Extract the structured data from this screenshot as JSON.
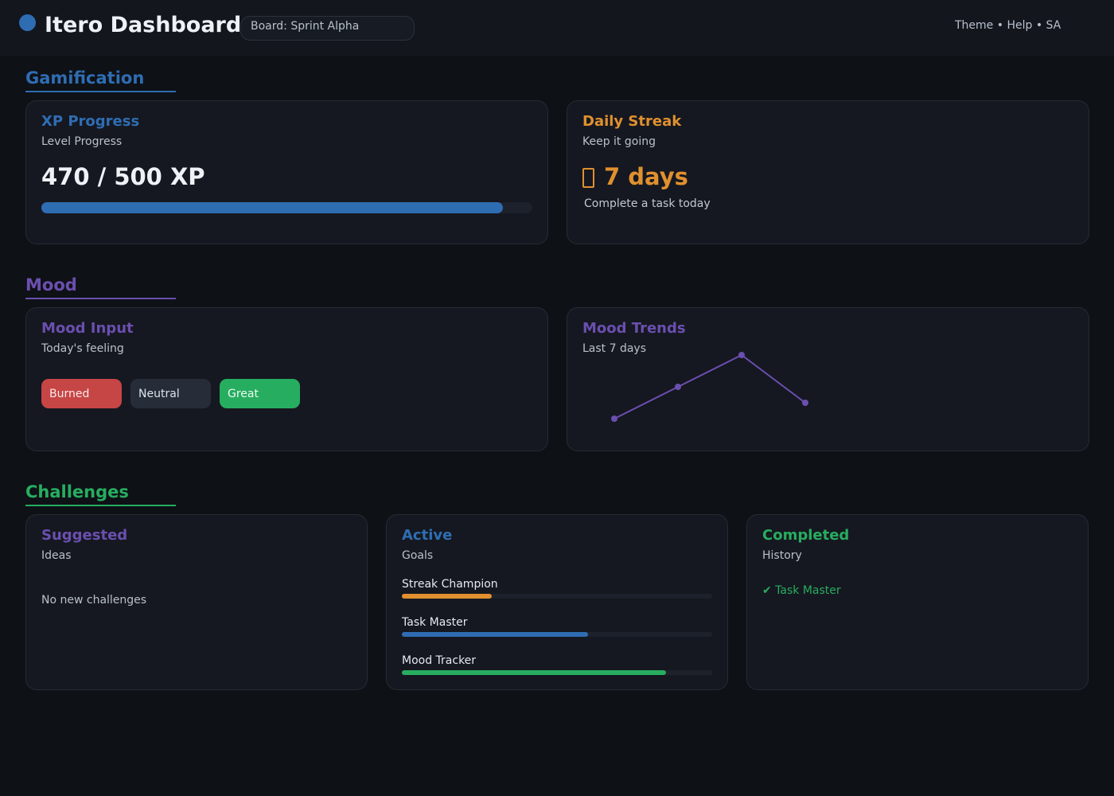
{
  "header": {
    "title": "Itero Dashboard",
    "board": "Board: Sprint Alpha",
    "links": "Theme • Help • SA"
  },
  "colors": {
    "blue": "#2f6db3",
    "orange": "#e0902f",
    "purple": "#6b4fb0",
    "green": "#27ad60",
    "red": "#c64545"
  },
  "sections": {
    "gamification": "Gamification",
    "mood": "Mood",
    "challenges": "Challenges"
  },
  "xp": {
    "title": "XP Progress",
    "subtitle": "Level Progress",
    "value": "470 / 500 XP",
    "progress": 0.94
  },
  "streak": {
    "title": "Daily Streak",
    "subtitle": "Keep it going",
    "icon": "fire-icon",
    "value": "7 days",
    "hint": "Complete a task today"
  },
  "mood_input": {
    "title": "Mood Input",
    "subtitle": "Today's feeling",
    "options": [
      "Burned",
      "Neutral",
      "Great"
    ]
  },
  "mood_trends": {
    "title": "Mood Trends",
    "subtitle": "Last 7 days",
    "values": [
      1,
      2,
      3,
      1.5
    ]
  },
  "challenges": {
    "suggested": {
      "title": "Suggested",
      "subtitle": "Ideas",
      "empty": "No new challenges"
    },
    "active": {
      "title": "Active",
      "subtitle": "Goals",
      "goals": [
        {
          "label": "Streak Champion",
          "progress": 0.29,
          "color": "#e0902f"
        },
        {
          "label": "Task Master",
          "progress": 0.6,
          "color": "#2f6db3"
        },
        {
          "label": "Mood Tracker",
          "progress": 0.85,
          "color": "#27ad60"
        }
      ]
    },
    "completed": {
      "title": "Completed",
      "subtitle": "History",
      "items": [
        "✔ Task Master"
      ]
    }
  }
}
